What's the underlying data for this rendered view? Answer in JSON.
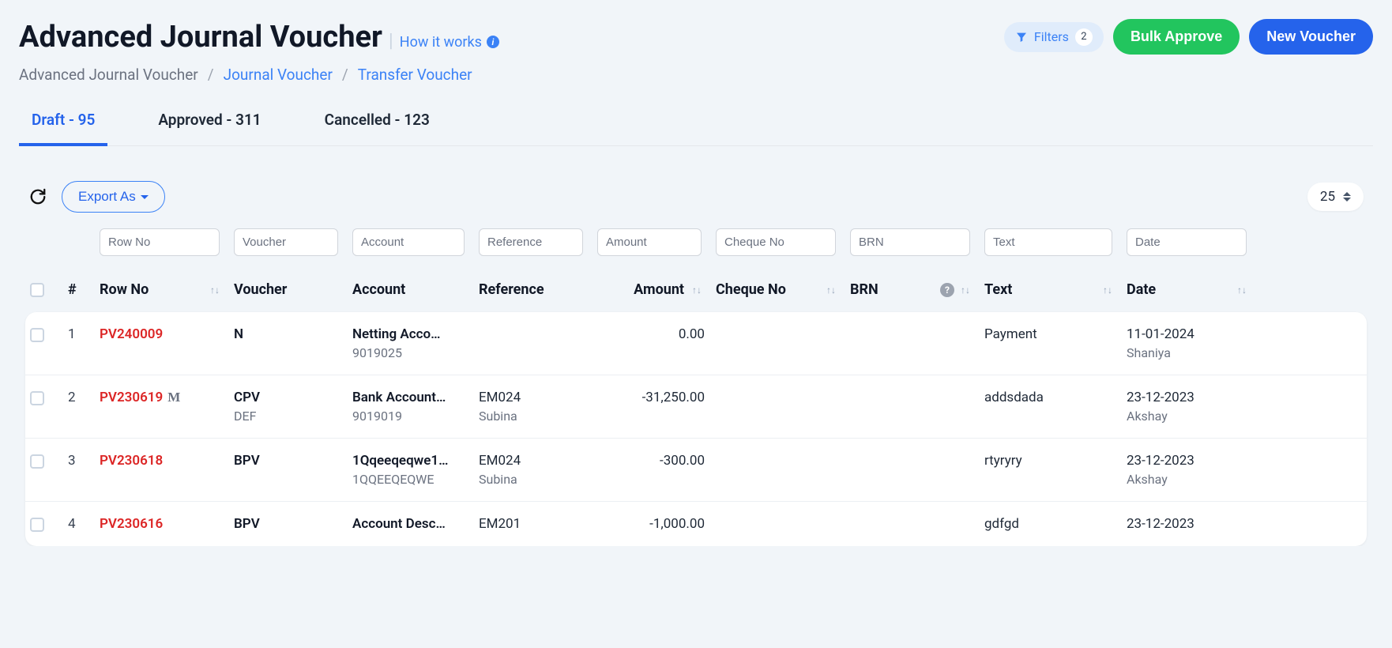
{
  "header": {
    "title": "Advanced Journal Voucher",
    "how_it_works": "How it works"
  },
  "actions": {
    "filters_label": "Filters",
    "filters_count": "2",
    "bulk_approve": "Bulk Approve",
    "new_voucher": "New Voucher"
  },
  "breadcrumb": {
    "items": [
      "Advanced Journal Voucher",
      "Journal Voucher",
      "Transfer Voucher"
    ]
  },
  "tabs": [
    {
      "label": "Draft - 95",
      "active": true
    },
    {
      "label": "Approved - 311",
      "active": false
    },
    {
      "label": "Cancelled - 123",
      "active": false
    }
  ],
  "toolbar": {
    "export_label": "Export As",
    "page_size": "25"
  },
  "filters": {
    "row_no": "Row No",
    "voucher": "Voucher",
    "account": "Account",
    "reference": "Reference",
    "amount": "Amount",
    "cheque_no": "Cheque No",
    "brn": "BRN",
    "text": "Text",
    "date": "Date"
  },
  "columns": {
    "hash": "#",
    "row_no": "Row No",
    "voucher": "Voucher",
    "account": "Account",
    "reference": "Reference",
    "amount": "Amount",
    "cheque_no": "Cheque No",
    "brn": "BRN",
    "text": "Text",
    "date": "Date"
  },
  "rows": [
    {
      "idx": "1",
      "row_no": "PV240009",
      "voucher": "N",
      "voucher_sub": "",
      "account": "Netting Acco…",
      "account_sub": "9019025",
      "reference": "",
      "reference_sub": "",
      "amount": "0.00",
      "cheque_no": "",
      "brn": "",
      "text": "Payment",
      "date": "11-01-2024",
      "date_sub": "Shaniya",
      "has_m": false
    },
    {
      "idx": "2",
      "row_no": "PV230619",
      "voucher": "CPV",
      "voucher_sub": "DEF",
      "account": "Bank Account…",
      "account_sub": "9019019",
      "reference": "EM024",
      "reference_sub": "Subina",
      "amount": "-31,250.00",
      "cheque_no": "",
      "brn": "",
      "text": "addsdada",
      "date": "23-12-2023",
      "date_sub": "Akshay",
      "has_m": true
    },
    {
      "idx": "3",
      "row_no": "PV230618",
      "voucher": "BPV",
      "voucher_sub": "",
      "account": "1Qqeeqeqwe1…",
      "account_sub": "1QQEEQEQWE",
      "reference": "EM024",
      "reference_sub": "Subina",
      "amount": "-300.00",
      "cheque_no": "",
      "brn": "",
      "text": "rtyryry",
      "date": "23-12-2023",
      "date_sub": "Akshay",
      "has_m": false
    },
    {
      "idx": "4",
      "row_no": "PV230616",
      "voucher": "BPV",
      "voucher_sub": "",
      "account": "Account Desc…",
      "account_sub": "",
      "reference": "EM201",
      "reference_sub": "",
      "amount": "-1,000.00",
      "cheque_no": "",
      "brn": "",
      "text": "gdfgd",
      "date": "23-12-2023",
      "date_sub": "",
      "has_m": false
    }
  ]
}
